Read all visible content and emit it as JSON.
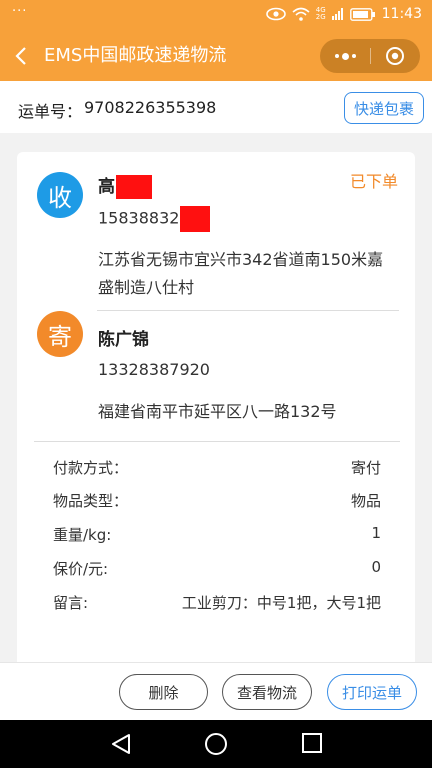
{
  "status_bar": {
    "left": "···",
    "net_top": "4G",
    "net_bottom": "2G",
    "time": "11:43"
  },
  "nav": {
    "title": "EMS中国邮政速递物流"
  },
  "tracking": {
    "label": "运单号：",
    "number": "9708226355398",
    "button": "快递包裹"
  },
  "receiver": {
    "avatar_char": "收",
    "name": "高",
    "phone": "15838832",
    "address": "江苏省无锡市宜兴市342省道南150米嘉盛制造八仕村"
  },
  "order_status": "已下单",
  "sender": {
    "avatar_char": "寄",
    "name": "陈广锦",
    "phone": "13328387920",
    "address": "福建省南平市延平区八一路132号"
  },
  "details": [
    {
      "key": "付款方式：",
      "value": "寄付"
    },
    {
      "key": "物品类型：",
      "value": "物品"
    },
    {
      "key": "重量/kg:",
      "value": "1"
    },
    {
      "key": "保价/元:",
      "value": "0"
    },
    {
      "key": "留言:",
      "value": "工业剪刀：中号1把，大号1把"
    }
  ],
  "actions": {
    "delete": "删除",
    "view_logistics": "查看物流",
    "print_waybill": "打印运单"
  },
  "colors": {
    "brand_orange": "#f7a13a",
    "receiver_blue": "#1e9be6",
    "sender_orange": "#f28a2a",
    "link_blue": "#3a8ee6",
    "redaction_red": "#ff1010"
  }
}
